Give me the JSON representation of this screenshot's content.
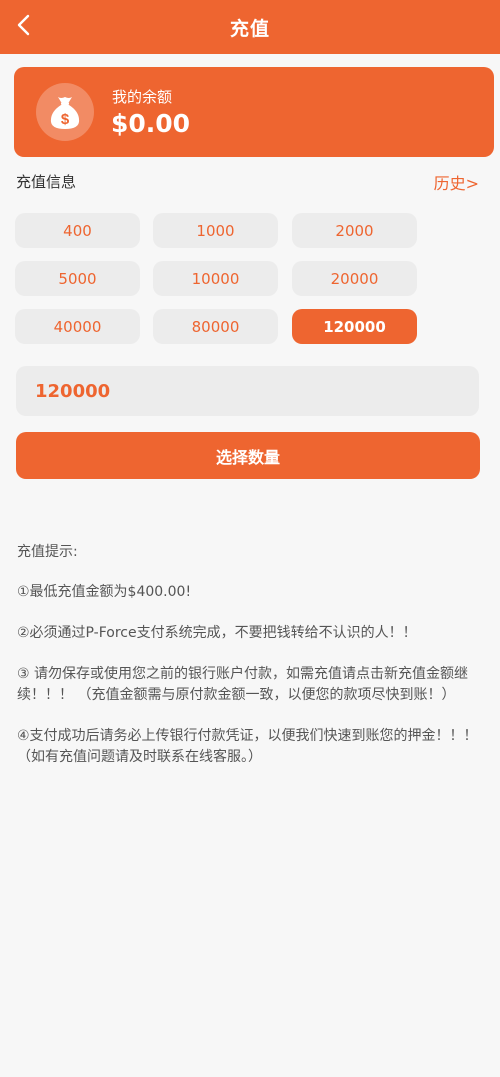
{
  "header": {
    "title": "充值"
  },
  "balance": {
    "label": "我的余额",
    "value": "$0.00"
  },
  "recharge": {
    "section_title": "充值信息",
    "history_link": "历史>",
    "amounts": [
      "400",
      "1000",
      "2000",
      "5000",
      "10000",
      "20000",
      "40000",
      "80000",
      "120000"
    ],
    "selected_amount": "120000",
    "input_value": "120000",
    "submit_label": "选择数量"
  },
  "tips": {
    "title": "充值提示:",
    "items": [
      "①最低充值金额为$400.00!",
      "②必须通过P-Force支付系统完成，不要把钱转给不认识的人！！",
      "③ 请勿保存或使用您之前的银行账户付款，如需充值请点击新充值金额继续！！！ （充值金额需与原付款金额一致，以便您的款项尽快到账！）",
      "④支付成功后请务必上传银行付款凭证，以便我们快速到账您的押金！！！ （如有充值问题请及时联系在线客服。）"
    ]
  },
  "colors": {
    "accent": "#ee6530",
    "button_bg": "#ececec",
    "page_bg": "#f7f7f7"
  }
}
